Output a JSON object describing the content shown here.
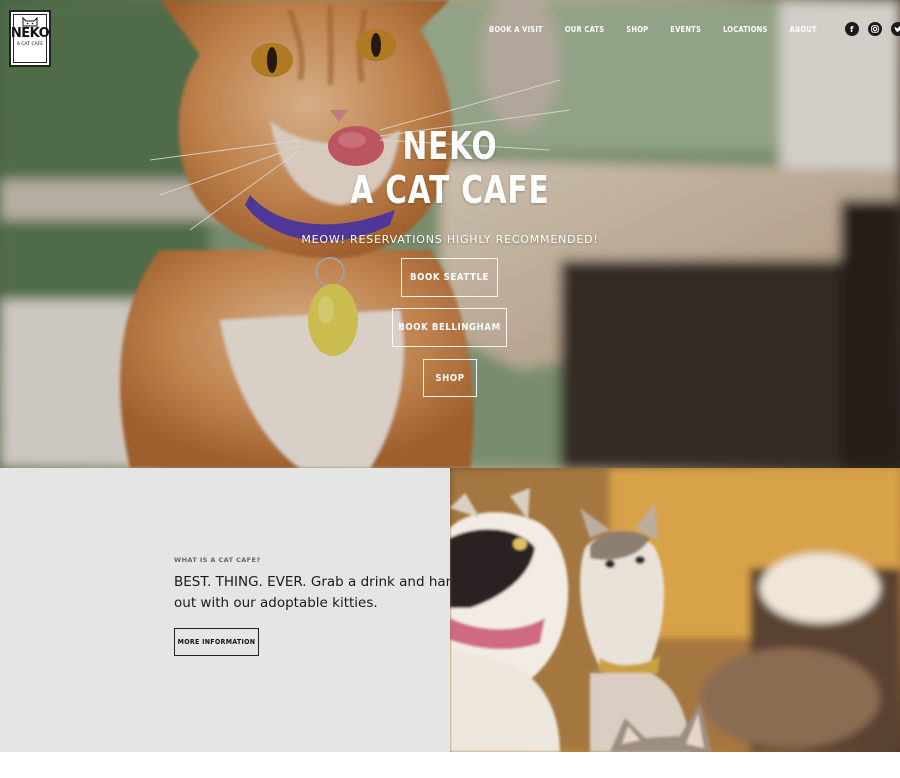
{
  "logo": {
    "word": "NEKO",
    "sub": "A CAT CAFE"
  },
  "nav": {
    "items": [
      "BOOK A VISIT",
      "OUR CATS",
      "SHOP",
      "EVENTS",
      "LOCATIONS",
      "ABOUT"
    ],
    "social": [
      "facebook-icon",
      "instagram-icon",
      "twitter-icon"
    ]
  },
  "hero": {
    "title_line1": "NEKO",
    "title_line2": "A CAT CAFE",
    "subtitle": "MEOW! RESERVATIONS HIGHLY RECOMMENDED!",
    "buttons": {
      "seattle": "BOOK SEATTLE",
      "bellingham": "BOOK BELLINGHAM",
      "shop": "SHOP"
    }
  },
  "info": {
    "kicker": "WHAT IS A CAT CAFE?",
    "text": "BEST. THING. EVER. Grab a drink and hang out with our adoptable kitties.",
    "button": "MORE INFORMATION"
  },
  "colors": {
    "button_border": "#ffffff",
    "info_bg": "#e5e5e5",
    "nav_text": "#ffffff"
  }
}
